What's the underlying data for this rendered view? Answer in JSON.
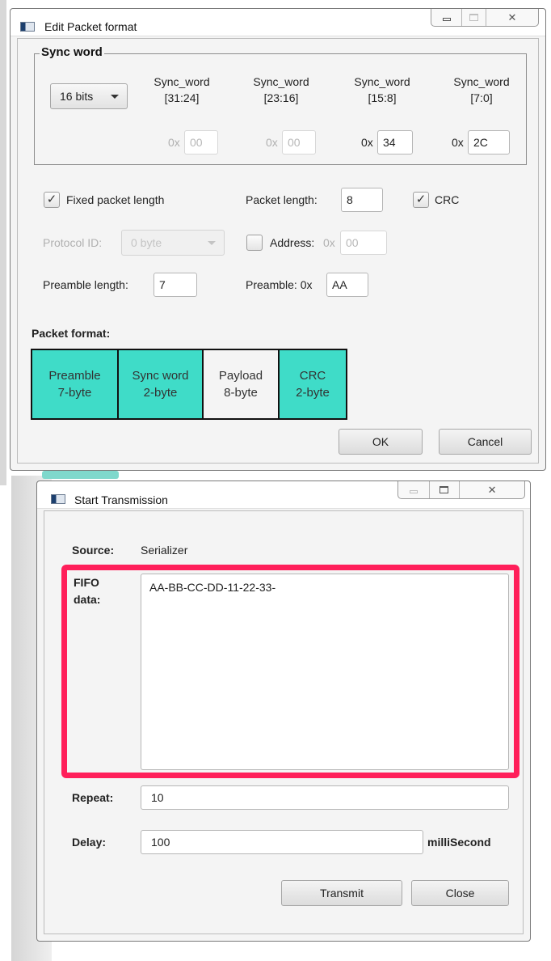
{
  "edit_packet_window": {
    "title": "Edit Packet format",
    "sync_word": {
      "legend": "Sync word",
      "bits_select": "16 bits",
      "fields": [
        {
          "header1": "Sync_word",
          "header2": "[31:24]",
          "prefix": "0x",
          "value": "00"
        },
        {
          "header1": "Sync_word",
          "header2": "[23:16]",
          "prefix": "0x",
          "value": "00"
        },
        {
          "header1": "Sync_word",
          "header2": "[15:8]",
          "prefix": "0x",
          "value": "34"
        },
        {
          "header1": "Sync_word",
          "header2": "[7:0]",
          "prefix": "0x",
          "value": "2C"
        }
      ]
    },
    "fixed_packet_length": {
      "label": "Fixed packet length",
      "checked": true
    },
    "packet_length": {
      "label": "Packet length:",
      "value": "8"
    },
    "crc": {
      "label": "CRC",
      "checked": true
    },
    "protocol_id": {
      "label": "Protocol ID:",
      "value": "0 byte"
    },
    "address": {
      "label": "Address:",
      "prefix": "0x",
      "value": "00",
      "checked": false
    },
    "preamble_length": {
      "label": "Preamble length:",
      "value": "7"
    },
    "preamble": {
      "label": "Preamble: 0x",
      "value": "AA"
    },
    "packet_format": {
      "heading": "Packet format:",
      "cells": [
        {
          "line1": "Preamble",
          "line2": "7-byte",
          "color": "#3fdcc8"
        },
        {
          "line1": "Sync word",
          "line2": "2-byte",
          "color": "#3fdcc8"
        },
        {
          "line1": "Payload",
          "line2": "8-byte",
          "color": "#f4f4f4"
        },
        {
          "line1": "CRC",
          "line2": "2-byte",
          "color": "#3fdcc8"
        }
      ]
    },
    "ok_label": "OK",
    "cancel_label": "Cancel"
  },
  "start_transmission_window": {
    "title": "Start Transmission",
    "source_label": "Source:",
    "source_value": "Serializer",
    "fifo_label_line1": "FIFO",
    "fifo_label_line2": "data:",
    "fifo_value": "AA-BB-CC-DD-11-22-33-",
    "repeat_label": "Repeat:",
    "repeat_value": "10",
    "delay_label": "Delay:",
    "delay_value": "100",
    "delay_unit": "milliSecond",
    "transmit_label": "Transmit",
    "close_label": "Close",
    "highlight_color": "#ff1f5a"
  }
}
